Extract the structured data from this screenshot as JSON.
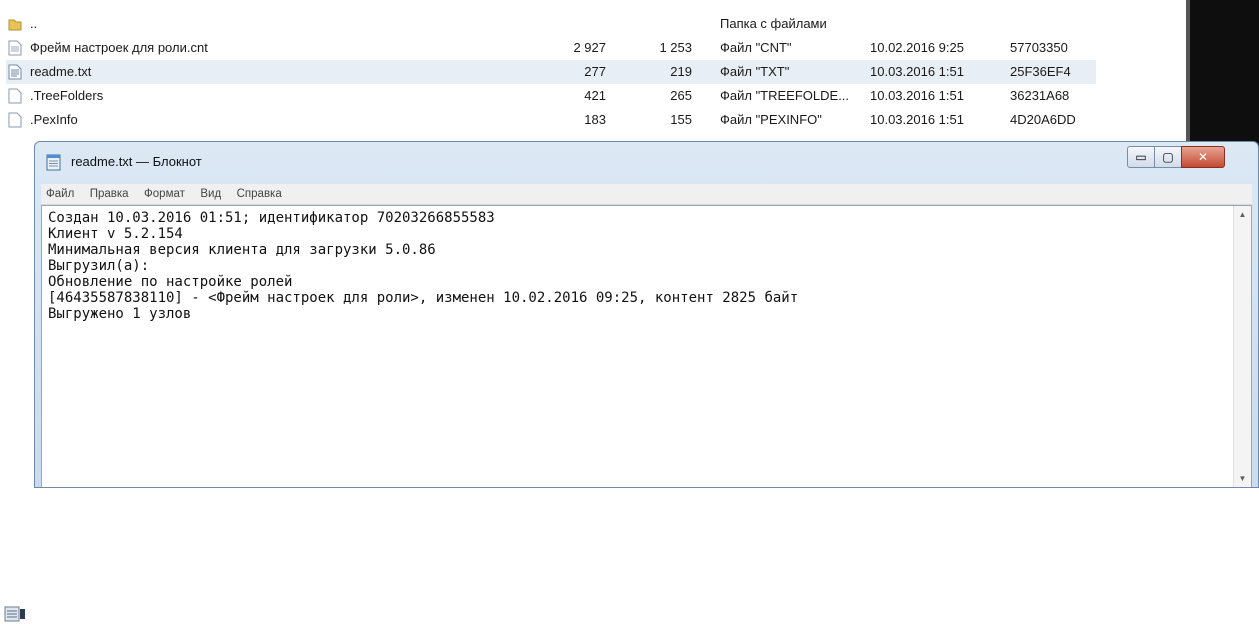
{
  "explorer": {
    "rows": [
      {
        "name": "..",
        "size": "",
        "packed": "",
        "type": "Папка с файлами",
        "date": "",
        "crc": "",
        "icon": "folder-up-icon"
      },
      {
        "name": "Фрейм настроек для роли.cnt",
        "size": "2 927",
        "packed": "1 253",
        "type": "Файл \"CNT\"",
        "date": "10.02.2016 9:25",
        "crc": "57703350",
        "icon": "file-icon"
      },
      {
        "name": "readme.txt",
        "size": "277",
        "packed": "219",
        "type": "Файл \"TXT\"",
        "date": "10.03.2016 1:51",
        "crc": "25F36EF4",
        "icon": "text-file-icon"
      },
      {
        "name": ".TreeFolders",
        "size": "421",
        "packed": "265",
        "type": "Файл \"TREEFOLDE...",
        "date": "10.03.2016 1:51",
        "crc": "36231A68",
        "icon": "file-icon"
      },
      {
        "name": ".PexInfo",
        "size": "183",
        "packed": "155",
        "type": "Файл \"PEXINFO\"",
        "date": "10.03.2016 1:51",
        "crc": "4D20A6DD",
        "icon": "file-icon"
      }
    ]
  },
  "notepad": {
    "title": "readme.txt — Блокнот",
    "menu": [
      "Файл",
      "Правка",
      "Формат",
      "Вид",
      "Справка"
    ],
    "content": "Создан 10.03.2016 01:51; идентификатор 70203266855583\nКлиент v 5.2.154\nМинимальная версия клиента для загрузки 5.0.86\nВыгрузил(а):\nОбновление по настройке ролей\n[46435587838110] - <Фрейм настроек для роли>, изменен 10.02.2016 09:25, контент 2825 байт\nВыгружено 1 узлов",
    "buttons": {
      "minimize": "▭",
      "maximize": "▢",
      "close": "✕"
    }
  }
}
